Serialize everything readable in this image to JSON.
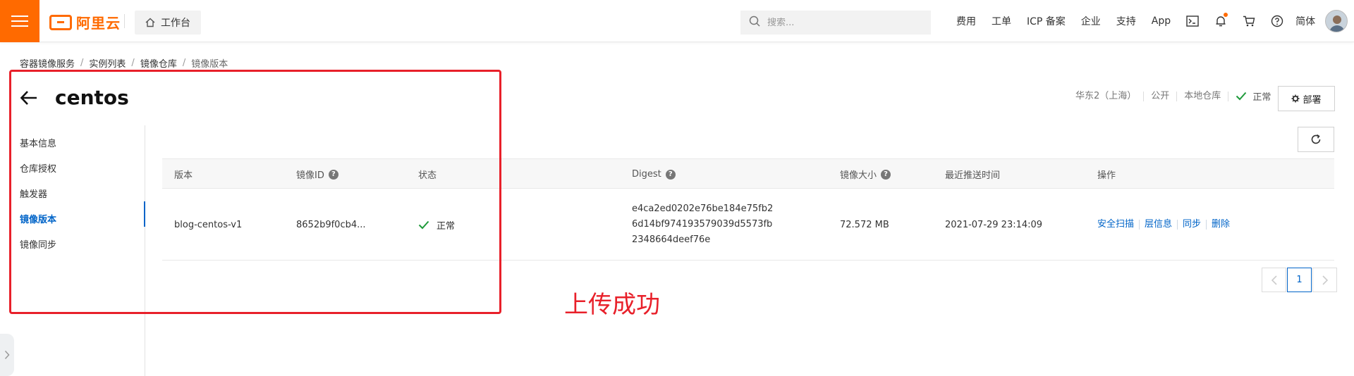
{
  "header": {
    "logo_text": "阿里云",
    "workbench_label": "工作台",
    "search_placeholder": "搜索...",
    "links": [
      "费用",
      "工单",
      "ICP 备案",
      "企业",
      "支持",
      "App"
    ],
    "lang_label": "简体",
    "accent_color": "#ff6a00"
  },
  "breadcrumb": [
    "容器镜像服务",
    "实例列表",
    "镜像仓库",
    "镜像版本"
  ],
  "page": {
    "title": "centos",
    "region": "华东2（上海）",
    "visibility": "公开",
    "repo_type": "本地仓库",
    "status": "正常",
    "deploy_label": "部署"
  },
  "sidenav": {
    "items": [
      "基本信息",
      "仓库授权",
      "触发器",
      "镜像版本",
      "镜像同步"
    ],
    "active_index": 3
  },
  "table": {
    "columns": [
      "版本",
      "镜像ID",
      "状态",
      "Digest",
      "镜像大小",
      "最近推送时间",
      "操作"
    ],
    "rows": [
      {
        "version": "blog-centos-v1",
        "image_id": "8652b9f0cb4...",
        "status": "正常",
        "digest_lines": [
          "e4ca2ed0202e76be184e75fb2",
          "6d14bf974193579039d5573fb",
          "2348664deef76e"
        ],
        "size": "72.572 MB",
        "pushed_at": "2021-07-29 23:14:09",
        "actions": [
          "安全扫描",
          "层信息",
          "同步",
          "删除"
        ]
      }
    ]
  },
  "pagination": {
    "current": "1"
  },
  "annotation": {
    "text": "上传成功",
    "color": "#e8202a"
  }
}
